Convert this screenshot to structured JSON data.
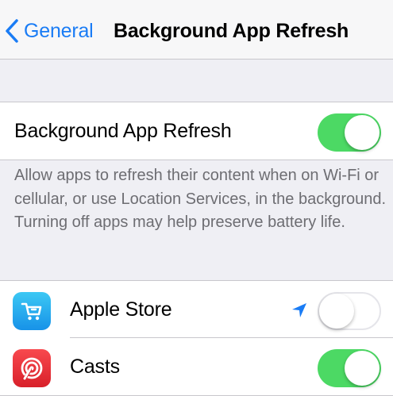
{
  "nav": {
    "back_label": "General",
    "title": "Background App Refresh"
  },
  "main_setting": {
    "label": "Background App Refresh",
    "enabled": true
  },
  "footer": {
    "text": "Allow apps to refresh their content when on Wi-Fi or cellular, or use Location Services, in the background. Turning off apps may help preserve battery life."
  },
  "apps": [
    {
      "name": "Apple Store",
      "icon": "shopping-cart-icon",
      "location_indicator": true,
      "enabled": false
    },
    {
      "name": "Casts",
      "icon": "podcast-icon",
      "location_indicator": false,
      "enabled": true
    }
  ],
  "colors": {
    "accent": "#1a7cf5",
    "toggle_on": "#4cd964",
    "background": "#efeff4",
    "footer_text": "#6d6d72"
  }
}
